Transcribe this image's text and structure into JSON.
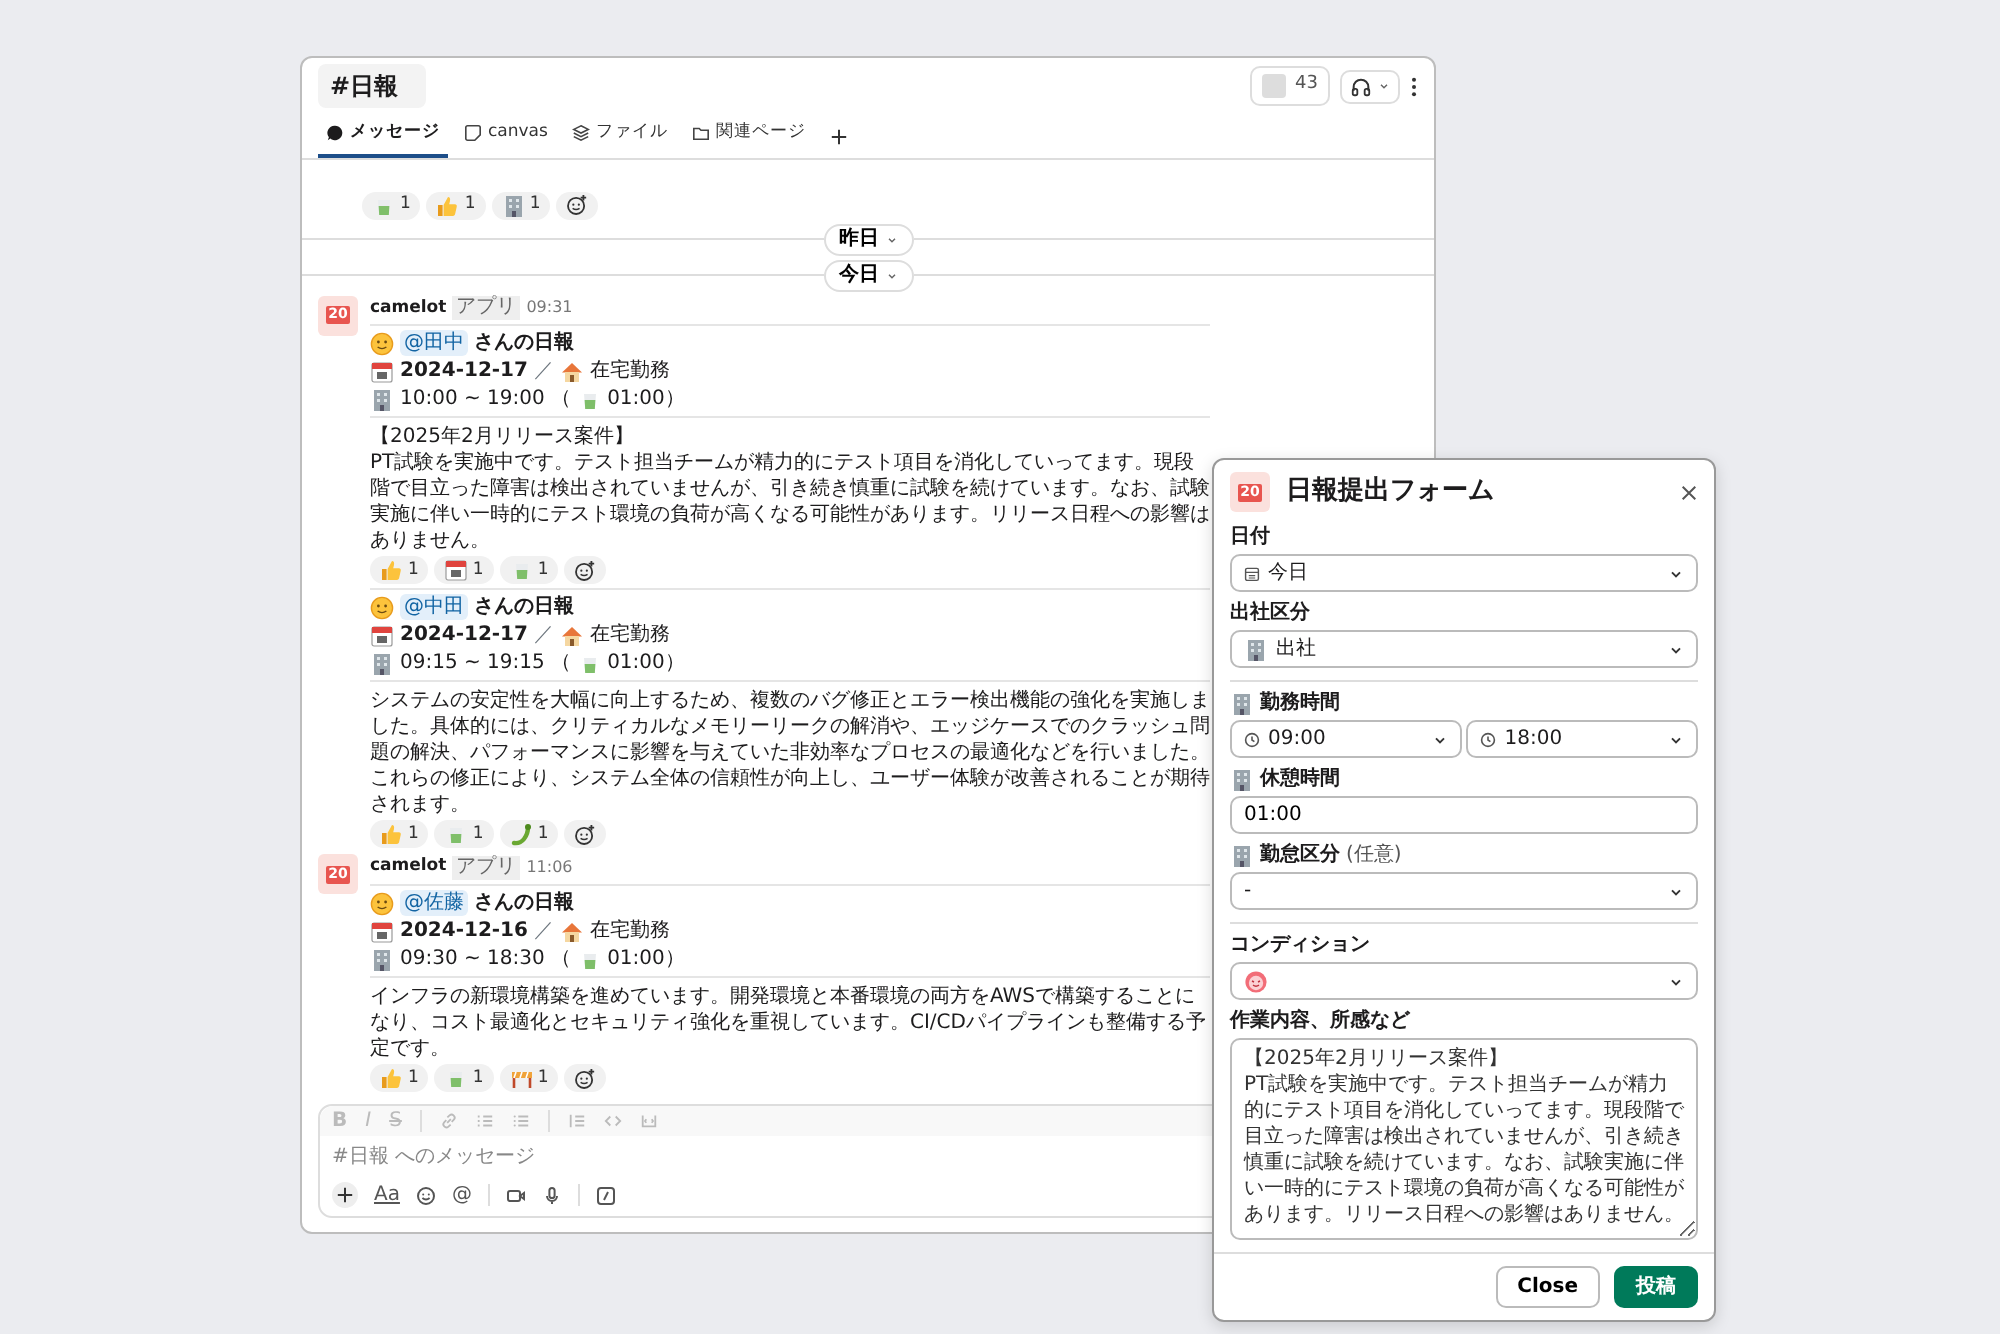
{
  "channel": {
    "title": "#日報",
    "member_count": "43"
  },
  "tabs": [
    {
      "label": "メッセージ",
      "selected": true
    },
    {
      "label": "canvas",
      "selected": false
    },
    {
      "label": "ファイル",
      "selected": false
    },
    {
      "label": "関連ページ",
      "selected": false
    }
  ],
  "feed": [
    {
      "kind": "reactions",
      "reactions": [
        {
          "kind": "tea",
          "count": "1"
        },
        {
          "kind": "thumbs",
          "count": "1"
        },
        {
          "kind": "building",
          "count": "1"
        }
      ]
    },
    {
      "kind": "divider",
      "label": "昨日"
    },
    {
      "kind": "divider",
      "label": "今日"
    },
    {
      "kind": "message",
      "logo_text": "20",
      "sender": "camelot",
      "badge": "アプリ",
      "time": "09:31",
      "reports": [
        {
          "mention": "@田中",
          "title": "さんの日報",
          "date": "2024-12-17",
          "separator": "／",
          "location": "在宅勤務",
          "hours": "10:00 ~ 19:00 （",
          "break": "01:00）",
          "body": "【2025年2月リリース案件】\nPT試験を実施中です。テスト担当チームが精力的にテスト項目を消化していってます。現段階で目立った障害は検出されていませんが、引き続き慎重に試験を続けています。なお、試験実施に伴い一時的にテスト環境の負荷が高くなる可能性があります。リリース日程への影響はありません。",
          "reactions": [
            {
              "kind": "thumbs",
              "count": "1"
            },
            {
              "kind": "calendar",
              "count": "1"
            },
            {
              "kind": "tea",
              "count": "1"
            }
          ]
        },
        {
          "mention": "@中田",
          "title": "さんの日報",
          "date": "2024-12-17",
          "separator": "／",
          "location": "在宅勤務",
          "hours": "09:15 ~ 19:15 （",
          "break": "01:00）",
          "body": "システムの安定性を大幅に向上するため、複数のバグ修正とエラー検出機能の強化を実施しました。具体的には、クリティカルなメモリーリークの解消や、エッジケースでのクラッシュ問題の解決、パフォーマンスに影響を与えていた非効率なプロセスの最適化などを行いました。これらの修正により、システム全体の信頼性が向上し、ユーザー体験が改善されることが期待されます。",
          "reactions": [
            {
              "kind": "thumbs",
              "count": "1"
            },
            {
              "kind": "tea",
              "count": "1"
            },
            {
              "kind": "bug",
              "count": "1"
            }
          ]
        }
      ]
    },
    {
      "kind": "message",
      "logo_text": "20",
      "sender": "camelot",
      "badge": "アプリ",
      "time": "11:06",
      "reports": [
        {
          "mention": "@佐藤",
          "title": "さんの日報",
          "date": "2024-12-16",
          "separator": "／",
          "location": "在宅勤務",
          "hours": "09:30 ~ 18:30 （",
          "break": "01:00）",
          "body": "インフラの新環境構築を進めています。開発環境と本番環境の両方をAWSで構築することになり、コスト最適化とセキュリティ強化を重視しています。CI/CDパイプラインも整備する予定です。",
          "reactions": [
            {
              "kind": "thumbs",
              "count": "1"
            },
            {
              "kind": "tea",
              "count": "1"
            },
            {
              "kind": "construction",
              "count": "1"
            }
          ]
        }
      ]
    }
  ],
  "composer": {
    "format_buttons": [
      "B",
      "I",
      "S"
    ],
    "placeholder": "#日報 へのメッセージ",
    "text_button": "Aa",
    "mention_button": "@"
  },
  "modal": {
    "logo_text": "20",
    "title": "日報提出フォーム",
    "fields": [
      {
        "kind": "date_select",
        "label": "日付",
        "value": "今日",
        "label_icon": false
      },
      {
        "kind": "place_select",
        "label": "出社区分",
        "value": "出社",
        "label_icon": false
      },
      {
        "kind": "rule"
      },
      {
        "kind": "time_range",
        "label": "勤務時間",
        "start": "09:00",
        "end": "18:00",
        "label_icon": true
      },
      {
        "kind": "text",
        "label": "休憩時間",
        "value": "01:00",
        "label_icon": true
      },
      {
        "kind": "select",
        "label": "勤怠区分",
        "hint": "(任意)",
        "value": "-",
        "label_icon": true
      },
      {
        "kind": "rule"
      },
      {
        "kind": "emoji_select",
        "label": "コンディション",
        "label_icon": false
      },
      {
        "kind": "textarea",
        "label": "作業内容、所感など",
        "value": "【2025年2月リリース案件】\nPT試験を実施中です。テスト担当チームが精力的にテスト項目を消化していってます。現段階で目立った障害は検出されていませんが、引き続き慎重に試験を続けています。なお、試験実施に伴い一時的にテスト環境の負荷が高くなる可能性があります。リリース日程への影響はありません。",
        "label_icon": false
      }
    ],
    "buttons": [
      {
        "kind": "secondary",
        "label": "Close"
      },
      {
        "kind": "primary",
        "label": "投稿"
      }
    ]
  }
}
